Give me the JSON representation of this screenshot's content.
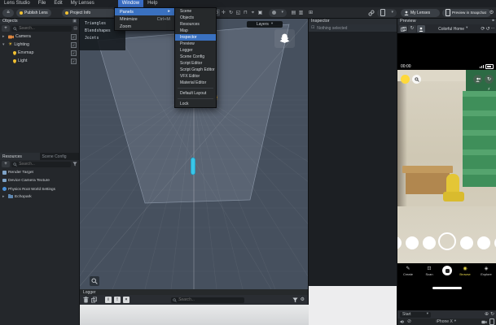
{
  "menu_bar": {
    "items": [
      "Lens Studio",
      "File",
      "Edit",
      "My Lenses",
      "Window",
      "Help"
    ],
    "active_item": "Window"
  },
  "window_menu": {
    "panels_label": "Panels",
    "minimize_label": "Minimize",
    "minimize_shortcut": "Ctrl+M",
    "zoom_label": "Zoom"
  },
  "panels_submenu": {
    "items": [
      "Scene",
      "Objects",
      "Resources",
      "Map",
      "Inspector",
      "Preview",
      "Logger",
      "Scene Config",
      "Script Editor",
      "Script Graph Editor",
      "VFX Editor",
      "Material Editor"
    ],
    "highlighted_item": "Inspector",
    "default_layout_label": "Default Layout",
    "lock_label": "Lock"
  },
  "toolbar": {
    "publish_label": "Publish Lens",
    "project_label": "Project Info",
    "my_lenses_label": "My Lenses",
    "preview_in_snapchat_label": "Preview in Snapchat"
  },
  "objects_panel": {
    "title": "Objects",
    "search_placeholder": "Search...",
    "items": [
      {
        "label": "Camera"
      },
      {
        "label": "Lighting"
      },
      {
        "label": "Envmap"
      },
      {
        "label": "Light"
      }
    ]
  },
  "resources_panel": {
    "tabs": [
      "Resources",
      "Scene Config"
    ],
    "active_tab": "Resources",
    "search_placeholder": "Search...",
    "items": [
      "Render Target",
      "Device Camera Texture",
      "Physics Root World Settings",
      "Echopark"
    ]
  },
  "scene_panel": {
    "layers_label": "Layers",
    "stats_labels": [
      "Triangles",
      "Blendshapes",
      "Joints"
    ]
  },
  "inspector_panel": {
    "title": "Inspector",
    "empty_message": "Nothing selected"
  },
  "logger_panel": {
    "title": "Logger",
    "search_placeholder": "Search..."
  },
  "preview_panel": {
    "title": "Preview",
    "scene_selector": "Colorful Home",
    "timer": "00:00",
    "nav_items": [
      "Create",
      "Scan",
      "Browse",
      "Explore"
    ],
    "active_nav": "Browse",
    "start_button_label": "Start",
    "device_label": "iPhone X"
  },
  "colors": {
    "menu_highlight": "#3a6ec6",
    "gizmo_yellow": "#f2b632",
    "selection_cyan": "#39c6e8",
    "snap_yellow": "#ffd93b"
  }
}
